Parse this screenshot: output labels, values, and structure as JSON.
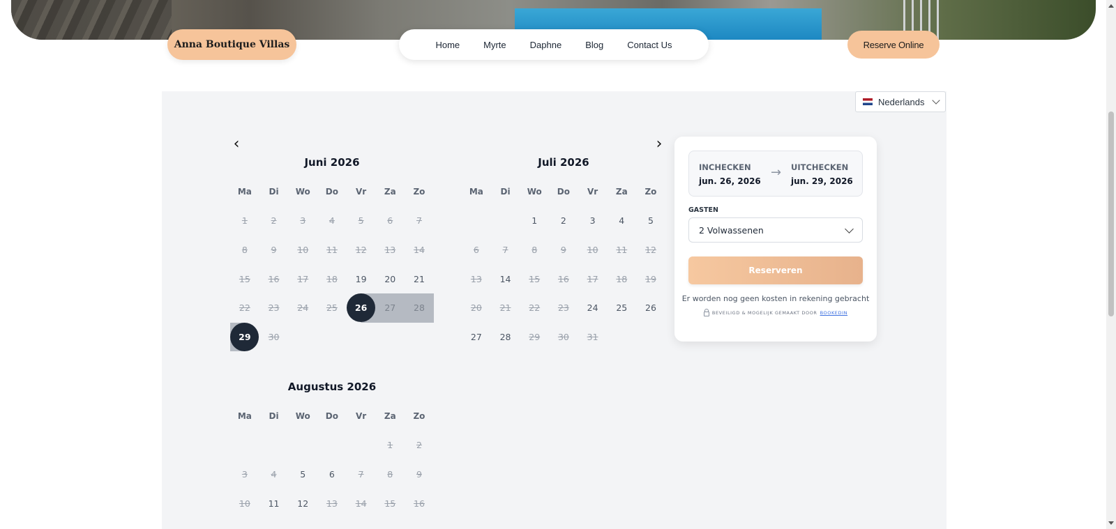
{
  "brand": "Anna Boutique Villas",
  "nav": {
    "items": [
      "Home",
      "Myrte",
      "Daphne",
      "Blog",
      "Contact Us"
    ]
  },
  "header": {
    "reserve_label": "Reserve Online"
  },
  "language": {
    "label": "Nederlands"
  },
  "calendar": {
    "weekdays": [
      "Ma",
      "Di",
      "Wo",
      "Do",
      "Vr",
      "Za",
      "Zo"
    ],
    "months": [
      {
        "title": "Juni 2026",
        "offset": 0,
        "days": 30,
        "available_from": 19,
        "unavailable": [
          22,
          23,
          24,
          25,
          27,
          28,
          30
        ],
        "selected_start": 26,
        "selected_end": 29,
        "in_range": [
          27,
          28
        ]
      },
      {
        "title": "Juli 2026",
        "offset": 2,
        "days": 31,
        "unavailable": [
          6,
          7,
          8,
          9,
          10,
          11,
          12,
          13,
          15,
          16,
          17,
          18,
          19,
          20,
          21,
          22,
          23,
          29,
          30,
          31
        ]
      },
      {
        "title": "Augustus 2026",
        "offset": 5,
        "days": 16,
        "unavailable": [
          1,
          2,
          3,
          4,
          7,
          8,
          9,
          10,
          13,
          14,
          15,
          16
        ]
      }
    ]
  },
  "booking": {
    "checkin_label": "INCHECKEN",
    "checkin_value": "jun. 26, 2026",
    "checkout_label": "UITCHECKEN",
    "checkout_value": "jun. 29, 2026",
    "guests_label": "GASTEN",
    "guests_value": "2 Volwassenen",
    "reserve_button": "Reserveren",
    "no_costs": "Er worden nog geen kosten in rekening gebracht",
    "secure_text": "Beveiligd & mogelijk gemaakt door",
    "secure_link": "Bookedin"
  }
}
